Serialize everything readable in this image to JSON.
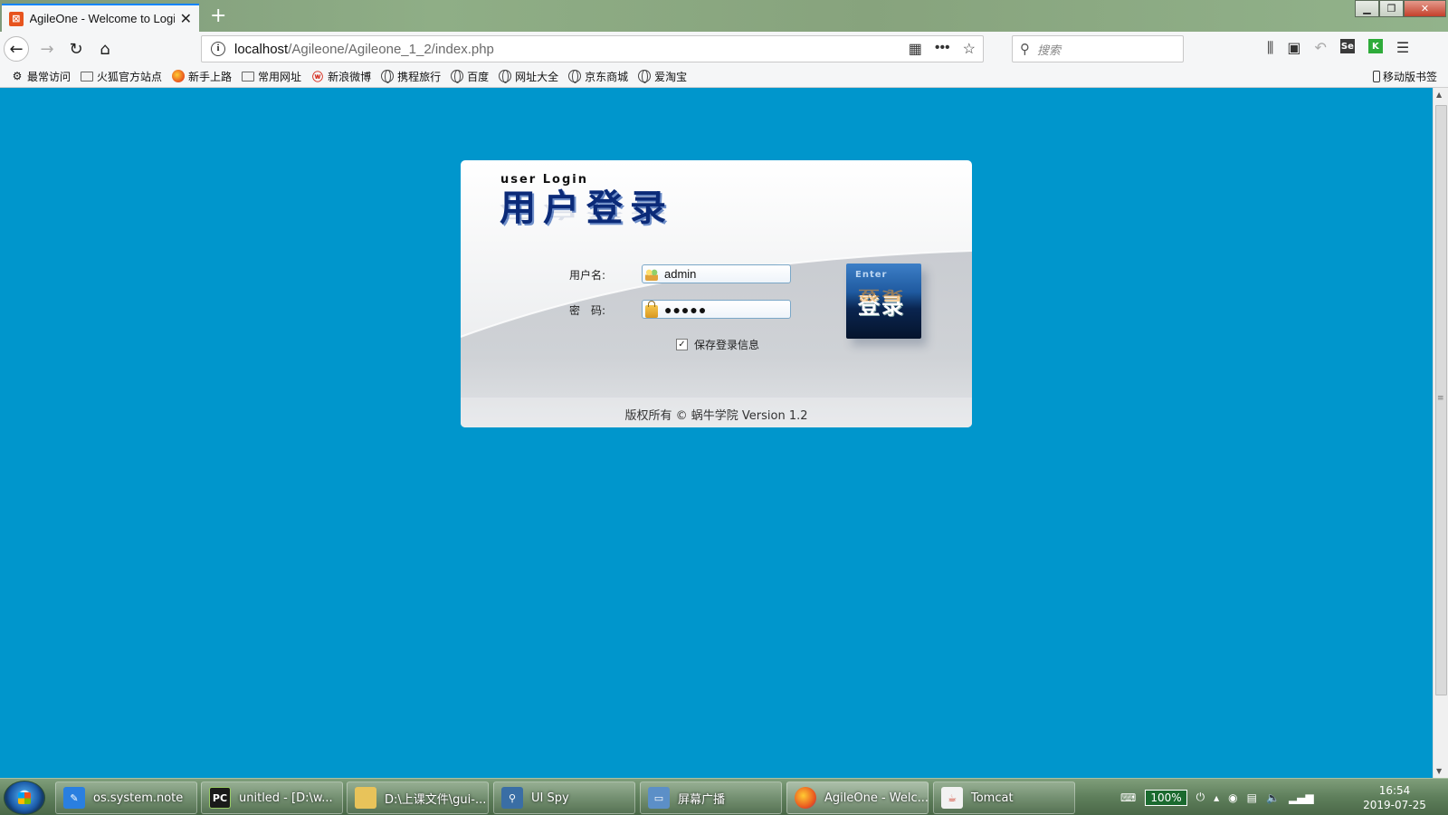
{
  "browser": {
    "tab_title": "AgileOne - Welcome to Logi",
    "url_host": "localhost",
    "url_path": "/Agileone/Agileone_1_2/index.php",
    "search_placeholder": "搜索",
    "bookmarks": [
      {
        "label": "最常访问",
        "icon": "gear-icon"
      },
      {
        "label": "火狐官方站点",
        "icon": "folder-icon"
      },
      {
        "label": "新手上路",
        "icon": "firefox-icon"
      },
      {
        "label": "常用网址",
        "icon": "folder-icon"
      },
      {
        "label": "新浪微博",
        "icon": "weibo-icon"
      },
      {
        "label": "携程旅行",
        "icon": "globe-icon"
      },
      {
        "label": "百度",
        "icon": "globe-icon"
      },
      {
        "label": "网址大全",
        "icon": "globe-icon"
      },
      {
        "label": "京东商城",
        "icon": "globe-icon"
      },
      {
        "label": "爱淘宝",
        "icon": "globe-icon"
      }
    ],
    "mobile_bookmarks": "移动版书签"
  },
  "login": {
    "subtitle": "user Login",
    "title": "用户登录",
    "username_label": "用户名:",
    "username_value": "admin",
    "password_label": "密　码:",
    "password_masked": "●●●●●",
    "remember_checked": true,
    "remember_label": "保存登录信息",
    "enter_en": "Enter",
    "enter_cn": "登录",
    "copyright": "版权所有 © 蜗牛学院   Version 1.2"
  },
  "taskbar": {
    "tasks": [
      {
        "label": "os.system.note",
        "icon": "note-icon",
        "color": "#2a7fe0"
      },
      {
        "label": "unitled - [D:\\w...",
        "icon": "pycharm-icon",
        "color": "#1a1a1a"
      },
      {
        "label": "D:\\上课文件\\gui-...",
        "icon": "folder-icon",
        "color": "#e8c35a"
      },
      {
        "label": "UI Spy",
        "icon": "uispy-icon",
        "color": "#3a6ea5"
      },
      {
        "label": "屏幕广播",
        "icon": "broadcast-icon",
        "color": "#5c8fc7"
      },
      {
        "label": "AgileOne - Welc...",
        "icon": "firefox-icon",
        "color": "#e8531f"
      },
      {
        "label": "Tomcat",
        "icon": "java-icon",
        "color": "#f2f2f2"
      }
    ],
    "battery": "100%",
    "time": "16:54",
    "date": "2019-07-25"
  }
}
